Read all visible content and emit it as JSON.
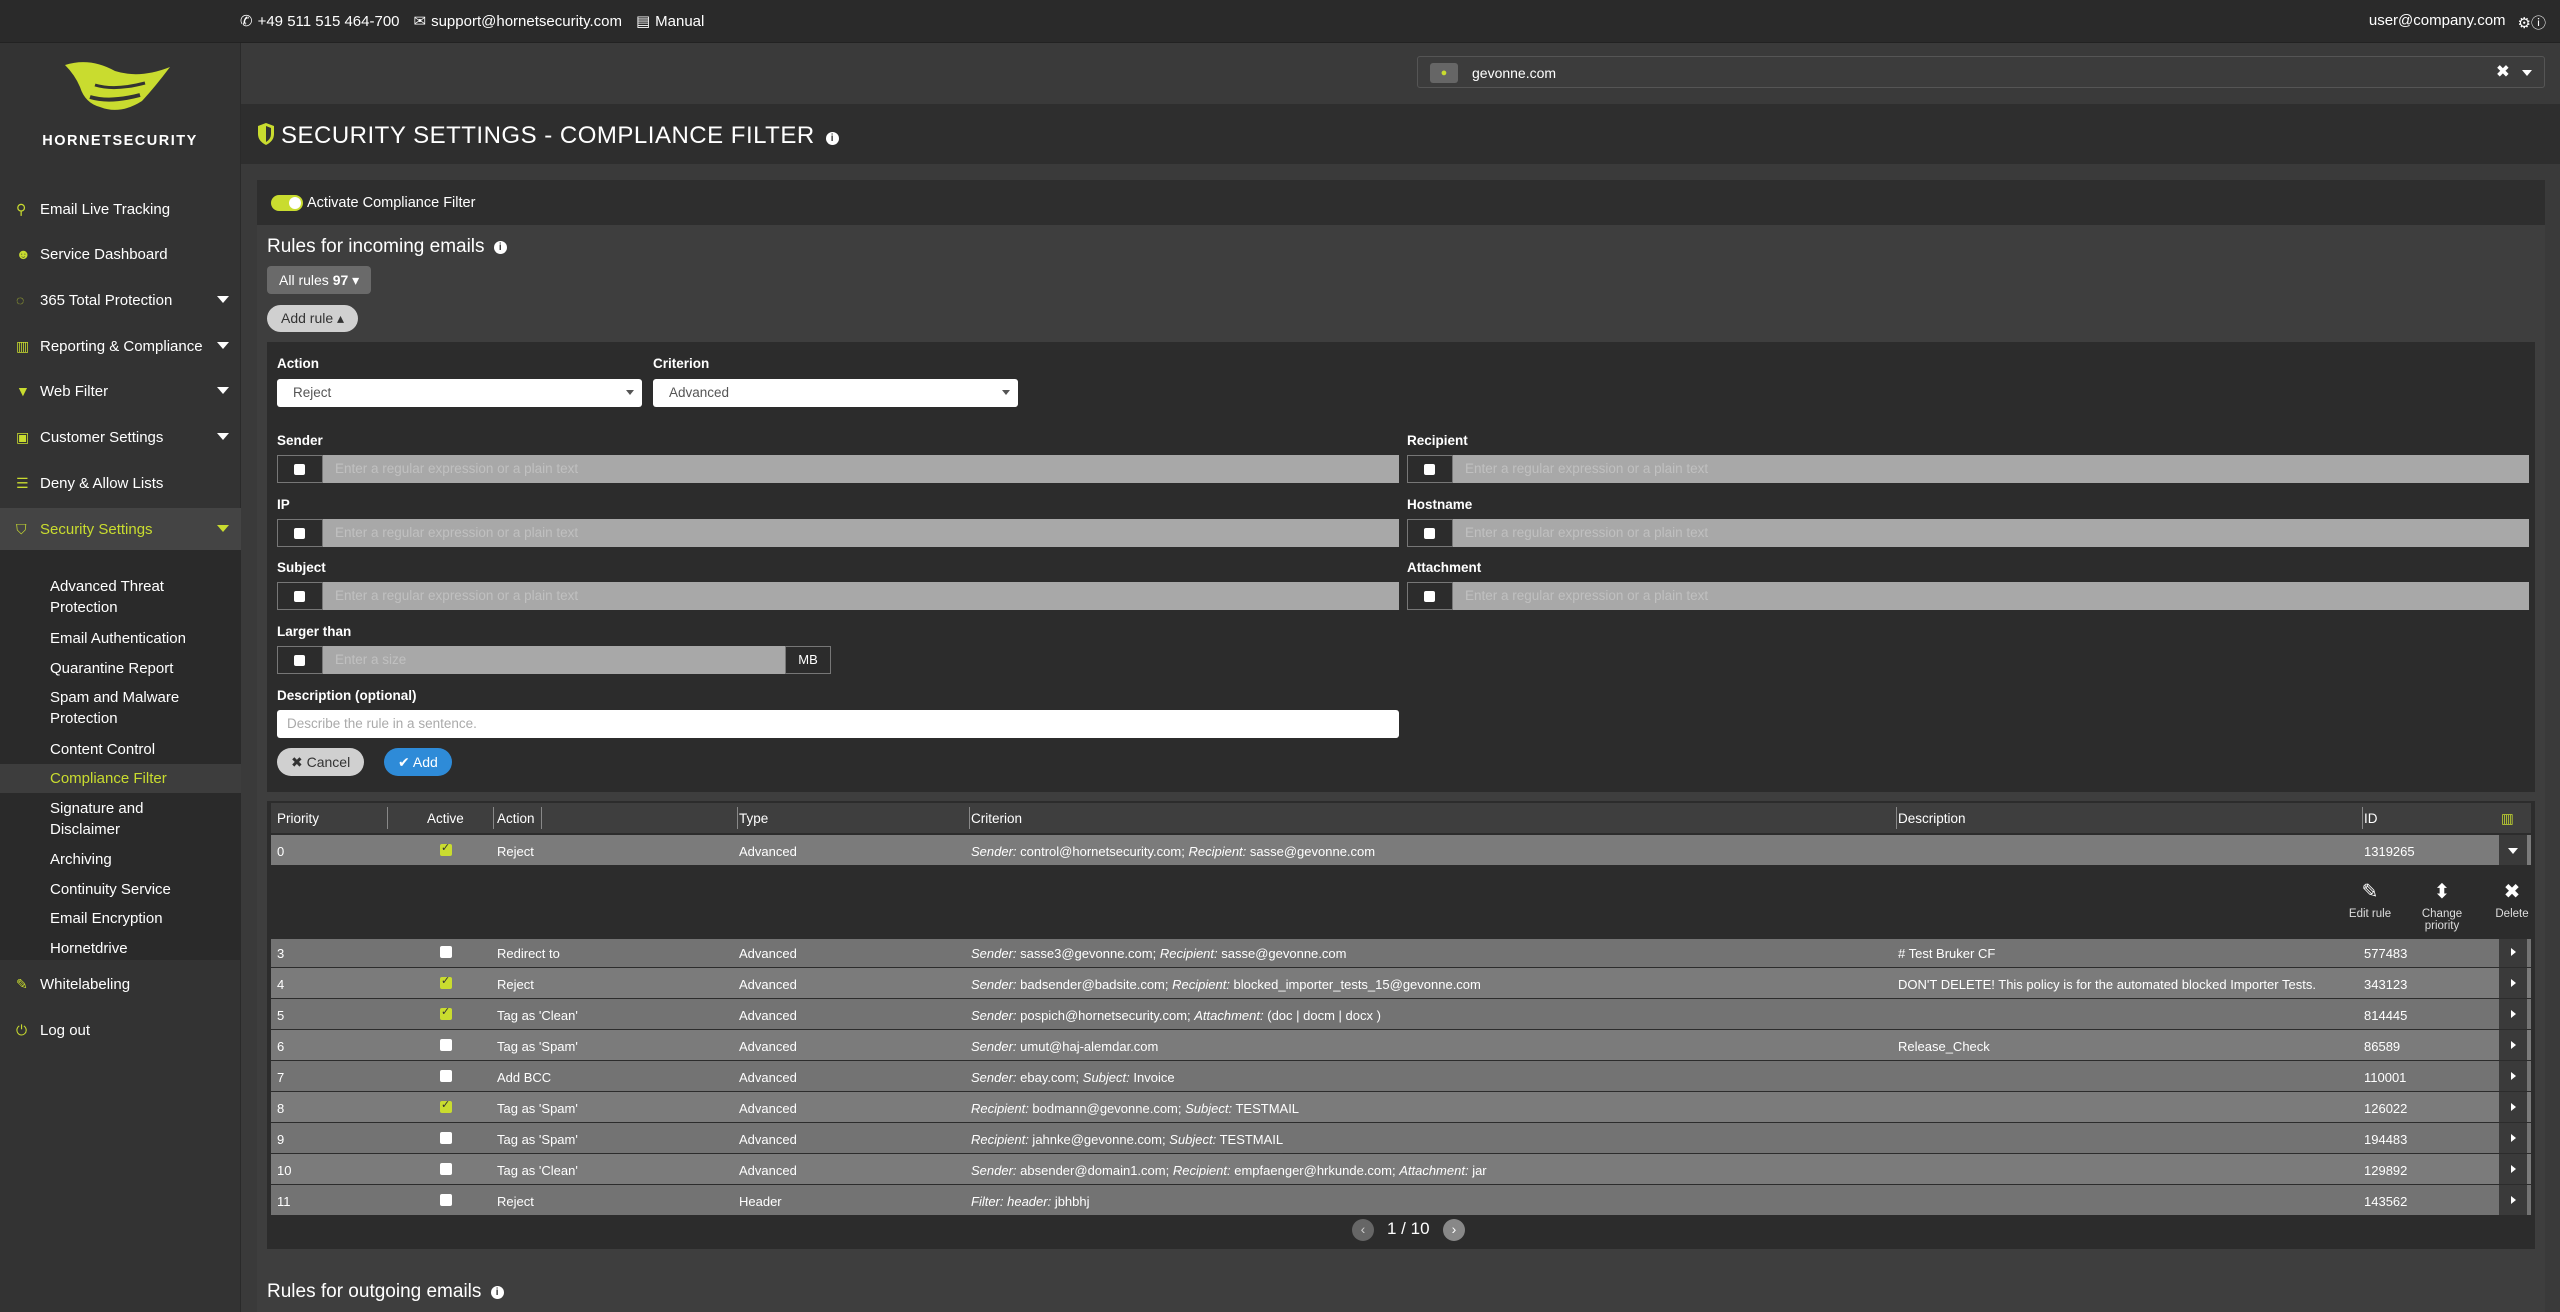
{
  "topbar": {
    "phone": "+49 511 515 464-700",
    "email": "support@hornetsecurity.com",
    "manual": "Manual",
    "user": "user@company.com"
  },
  "brand": {
    "name": "HORNETSECURITY",
    "accent": "#c9dc2f"
  },
  "domain": {
    "value": "gevonne.com"
  },
  "sidebar": {
    "items": [
      {
        "label": "Email Live Tracking",
        "icon": "search-icon"
      },
      {
        "label": "Service Dashboard",
        "icon": "users-icon"
      },
      {
        "label": "365 Total Protection",
        "icon": "circle-icon"
      },
      {
        "label": "Reporting & Compliance",
        "icon": "bar-chart-icon"
      },
      {
        "label": "Web Filter",
        "icon": "filter-icon"
      },
      {
        "label": "Customer Settings",
        "icon": "id-card-icon"
      },
      {
        "label": "Deny & Allow Lists",
        "icon": "list-icon"
      },
      {
        "label": "Security Settings",
        "icon": "shield-icon"
      },
      {
        "label": "Whitelabeling",
        "icon": "edit-icon"
      },
      {
        "label": "Log out",
        "icon": "power-icon"
      }
    ],
    "security_sub": [
      "Advanced Threat Protection",
      "Email Authentication",
      "Quarantine Report",
      "Spam and Malware Protection",
      "Content Control",
      "Compliance Filter",
      "Signature and Disclaimer",
      "Archiving",
      "Continuity Service",
      "Email Encryption",
      "Hornetdrive"
    ]
  },
  "page": {
    "title": "SECURITY SETTINGS - COMPLIANCE FILTER"
  },
  "filter": {
    "activate_label": "Activate Compliance Filter",
    "incoming_title": "Rules for incoming emails",
    "all_rules_label": "All rules",
    "all_rules_count": "97",
    "add_rule_label": "Add rule",
    "outgoing_title": "Rules for outgoing emails"
  },
  "form": {
    "action_label": "Action",
    "action_value": "Reject",
    "criterion_label": "Criterion",
    "criterion_value": "Advanced",
    "sender_label": "Sender",
    "recipient_label": "Recipient",
    "ip_label": "IP",
    "hostname_label": "Hostname",
    "subject_label": "Subject",
    "attachment_label": "Attachment",
    "larger_label": "Larger than",
    "regex_placeholder": "Enter a regular expression or a plain text",
    "size_placeholder": "Enter a size",
    "unit": "MB",
    "description_label": "Description (optional)",
    "description_placeholder": "Describe the rule in a sentence.",
    "cancel_label": "Cancel",
    "add_label": "Add"
  },
  "table": {
    "headers": [
      "Priority",
      "Active",
      "Action",
      "Type",
      "Criterion",
      "Description",
      "ID"
    ],
    "actions": {
      "edit": "Edit rule",
      "change": "Change priority",
      "delete": "Delete"
    },
    "rows": [
      {
        "priority": "0",
        "active": true,
        "action": "Reject",
        "type": "Advanced",
        "criterion": [
          [
            "Sender:",
            " control@hornetsecurity.com; "
          ],
          [
            "Recipient:",
            " sasse@gevonne.com"
          ]
        ],
        "description": "",
        "id": "1319265"
      },
      {
        "priority": "3",
        "active": false,
        "action": "Redirect to",
        "type": "Advanced",
        "criterion": [
          [
            "Sender:",
            " sasse3@gevonne.com; "
          ],
          [
            "Recipient:",
            " sasse@gevonne.com"
          ]
        ],
        "description": "# Test Bruker CF",
        "id": "577483"
      },
      {
        "priority": "4",
        "active": true,
        "action": "Reject",
        "type": "Advanced",
        "criterion": [
          [
            "Sender:",
            " badsender@badsite.com; "
          ],
          [
            "Recipient:",
            " blocked_importer_tests_15@gevonne.com"
          ]
        ],
        "description": "DON'T DELETE! This policy is for the automated blocked Importer Tests.",
        "id": "343123"
      },
      {
        "priority": "5",
        "active": true,
        "action": "Tag as 'Clean'",
        "type": "Advanced",
        "criterion": [
          [
            "Sender:",
            " pospich@hornetsecurity.com; "
          ],
          [
            "Attachment:",
            " (doc | docm | docx )"
          ]
        ],
        "description": "",
        "id": "814445"
      },
      {
        "priority": "6",
        "active": false,
        "action": "Tag as 'Spam'",
        "type": "Advanced",
        "criterion": [
          [
            "Sender:",
            " umut@haj-alemdar.com"
          ]
        ],
        "description": "Release_Check",
        "id": "86589"
      },
      {
        "priority": "7",
        "active": false,
        "action": "Add BCC",
        "type": "Advanced",
        "criterion": [
          [
            "Sender:",
            " ebay.com; "
          ],
          [
            "Subject:",
            " Invoice"
          ]
        ],
        "description": "",
        "id": "110001"
      },
      {
        "priority": "8",
        "active": true,
        "action": "Tag as 'Spam'",
        "type": "Advanced",
        "criterion": [
          [
            "Recipient:",
            " bodmann@gevonne.com; "
          ],
          [
            "Subject:",
            " TESTMAIL"
          ]
        ],
        "description": "",
        "id": "126022"
      },
      {
        "priority": "9",
        "active": false,
        "action": "Tag as 'Spam'",
        "type": "Advanced",
        "criterion": [
          [
            "Recipient:",
            " jahnke@gevonne.com; "
          ],
          [
            "Subject:",
            " TESTMAIL"
          ]
        ],
        "description": "",
        "id": "194483"
      },
      {
        "priority": "10",
        "active": false,
        "action": "Tag as 'Clean'",
        "type": "Advanced",
        "criterion": [
          [
            "Sender:",
            " absender@domain1.com; "
          ],
          [
            "Recipient:",
            " empfaenger@hrkunde.com; "
          ],
          [
            "Attachment:",
            " jar"
          ]
        ],
        "description": "",
        "id": "129892"
      },
      {
        "priority": "11",
        "active": false,
        "action": "Reject",
        "type": "Header",
        "criterion": [
          [
            "Filter: header:",
            " jbhbhj"
          ]
        ],
        "description": "",
        "id": "143562"
      }
    ]
  },
  "pager": {
    "text": "1 / 10"
  }
}
